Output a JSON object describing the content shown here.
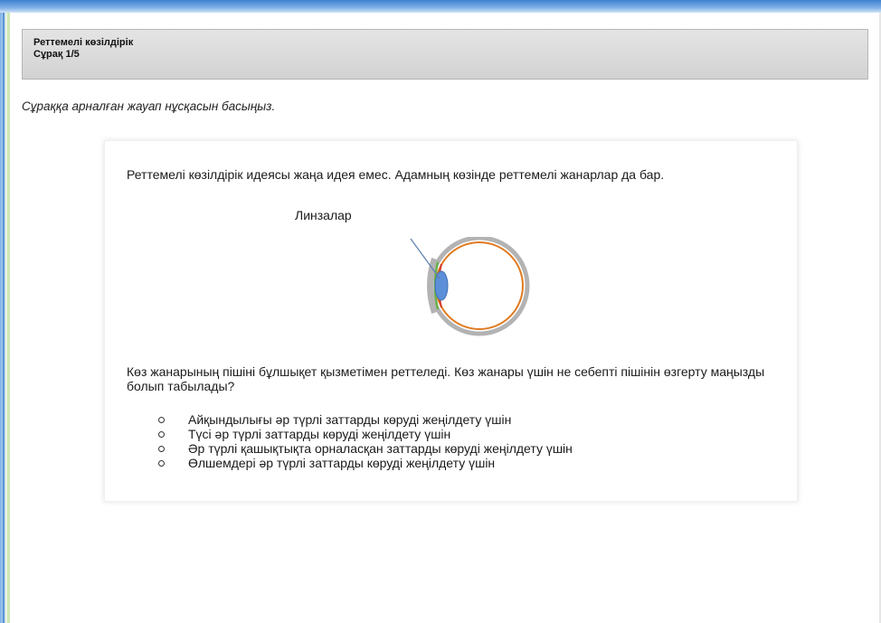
{
  "header": {
    "title": "Реттемелі көзілдірік",
    "counter": "Сұрақ 1/5"
  },
  "instruction": "Сұраққа арналған жауап нұсқасын басыңыз.",
  "stimulus": {
    "intro": "Реттемелі көзілдірік идеясы жаңа идея емес. Адамның көзінде реттемелі жанарлар да бар.",
    "figure_label": "Линзалар"
  },
  "question": "Көз жанарының пішіні бұлшықет қызметімен реттеледі. Көз жанары үшін не себепті пішінін өзгерту маңызды болып табылады?",
  "options": [
    "Айқындылығы әр түрлі заттарды көруді жеңілдету үшін",
    "Түсі әр түрлі заттарды көруді жеңілдету үшін",
    "Әр түрлі қашықтықта орналасқан заттарды көруді жеңілдету үшін",
    "Өлшемдері әр түрлі заттарды көруді жеңілдету үшін"
  ],
  "colors": {
    "window_blue": "#3f7fcf",
    "sclera": "#b3b3b3",
    "retina": "#e07a1f",
    "lens": "#5b8fd8",
    "ciliary": "#6bb04a",
    "iris": "#d23b2b"
  }
}
